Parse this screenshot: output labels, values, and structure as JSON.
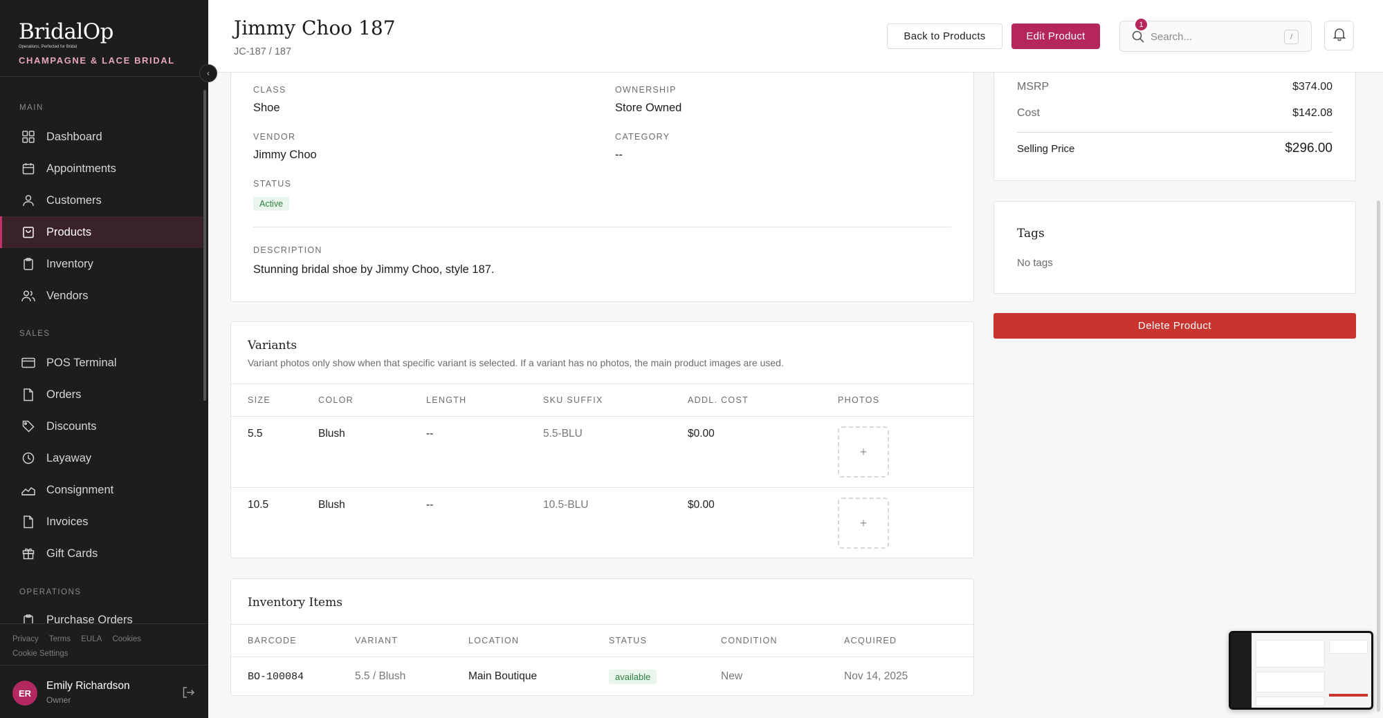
{
  "brand": {
    "name": "BridalOp",
    "tagline": "Operations, Perfected for Bridal",
    "store": "CHAMPAGNE & LACE BRIDAL"
  },
  "sidebar": {
    "sections": {
      "main": "MAIN",
      "sales": "SALES",
      "operations": "OPERATIONS"
    },
    "main_items": [
      {
        "label": "Dashboard",
        "icon": "grid-icon"
      },
      {
        "label": "Appointments",
        "icon": "calendar-icon"
      },
      {
        "label": "Customers",
        "icon": "user-icon"
      },
      {
        "label": "Products",
        "icon": "bag-icon",
        "active": true
      },
      {
        "label": "Inventory",
        "icon": "clipboard-icon"
      },
      {
        "label": "Vendors",
        "icon": "users-icon"
      }
    ],
    "sales_items": [
      {
        "label": "POS Terminal",
        "icon": "card-icon"
      },
      {
        "label": "Orders",
        "icon": "file-icon"
      },
      {
        "label": "Discounts",
        "icon": "tag-icon"
      },
      {
        "label": "Layaway",
        "icon": "clock-icon"
      },
      {
        "label": "Consignment",
        "icon": "chart-icon"
      },
      {
        "label": "Invoices",
        "icon": "file-icon"
      },
      {
        "label": "Gift Cards",
        "icon": "gift-icon"
      }
    ],
    "operations_items": [
      {
        "label": "Purchase Orders",
        "icon": "clipboard-icon"
      }
    ],
    "footer_links": [
      "Privacy",
      "Terms",
      "EULA",
      "Cookies"
    ],
    "cookie_settings": "Cookie Settings",
    "user": {
      "initials": "ER",
      "name": "Emily Richardson",
      "role": "Owner"
    }
  },
  "header": {
    "title": "Jimmy Choo 187",
    "subtitle": "JC-187 / 187",
    "back_label": "Back to Products",
    "edit_label": "Edit Product",
    "search_placeholder": "Search...",
    "search_shortcut": "/",
    "notification_count": "1"
  },
  "details": {
    "class_label": "CLASS",
    "class_value": "Shoe",
    "ownership_label": "OWNERSHIP",
    "ownership_value": "Store Owned",
    "vendor_label": "VENDOR",
    "vendor_value": "Jimmy Choo",
    "category_label": "CATEGORY",
    "category_value": "--",
    "status_label": "STATUS",
    "status_value": "Active",
    "description_label": "DESCRIPTION",
    "description_value": "Stunning bridal shoe by Jimmy Choo, style 187."
  },
  "pricing": {
    "msrp_label": "MSRP",
    "msrp_value": "$374.00",
    "cost_label": "Cost",
    "cost_value": "$142.08",
    "selling_label": "Selling Price",
    "selling_value": "$296.00"
  },
  "tags": {
    "title": "Tags",
    "empty": "No tags"
  },
  "delete_label": "Delete Product",
  "variants": {
    "title": "Variants",
    "description": "Variant photos only show when that specific variant is selected. If a variant has no photos, the main product images are used.",
    "columns": [
      "SIZE",
      "COLOR",
      "LENGTH",
      "SKU SUFFIX",
      "ADDL. COST",
      "PHOTOS"
    ],
    "rows": [
      {
        "size": "5.5",
        "color": "Blush",
        "length": "--",
        "sku": "5.5-BLU",
        "cost": "$0.00"
      },
      {
        "size": "10.5",
        "color": "Blush",
        "length": "--",
        "sku": "10.5-BLU",
        "cost": "$0.00"
      }
    ]
  },
  "inventory": {
    "title": "Inventory Items",
    "columns": [
      "BARCODE",
      "VARIANT",
      "LOCATION",
      "STATUS",
      "CONDITION",
      "ACQUIRED"
    ],
    "rows": [
      {
        "barcode": "BO-100084",
        "variant": "5.5 / Blush",
        "location": "Main Boutique",
        "status": "available",
        "condition": "New",
        "acquired": "Nov 14, 2025"
      }
    ]
  },
  "colors": {
    "accent": "#b4265c",
    "danger": "#c9342f",
    "sidebar_bg": "#1d1d1d",
    "success_bg": "#eaf5ec",
    "success_fg": "#2d7d3f"
  }
}
